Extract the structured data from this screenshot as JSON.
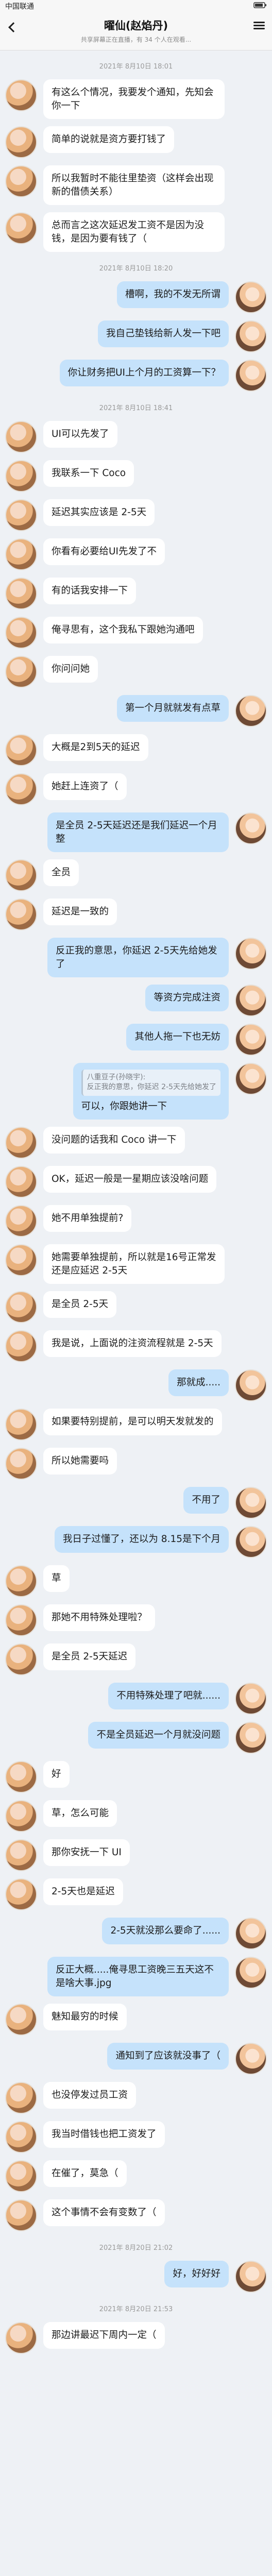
{
  "status_bar": {
    "carrier": "中国联通",
    "right_text": "",
    "battery_icon": "battery-icon"
  },
  "header": {
    "title": "曜仙(赵焰丹)",
    "notice": "共享屏幕正在直播，有 34 个人在观看...",
    "back_icon": "chevron-left-icon",
    "menu_icon": "menu-icon"
  },
  "messages": [
    {
      "type": "time",
      "text": "2021年 8月10日 18:01"
    },
    {
      "type": "msg",
      "side": "other",
      "text": "有这么个情况，我要发个通知，先知会你一下"
    },
    {
      "type": "msg",
      "side": "other",
      "text": "简单的说就是资方要打钱了"
    },
    {
      "type": "msg",
      "side": "other",
      "text": "所以我暂时不能往里垫资（这样会出现新的借债关系）"
    },
    {
      "type": "msg",
      "side": "other",
      "text": "总而言之这次延迟发工资不是因为没钱，是因为要有钱了（"
    },
    {
      "type": "time",
      "text": "2021年 8月10日 18:20"
    },
    {
      "type": "msg",
      "side": "me",
      "text": "槽啊，我的不发无所谓"
    },
    {
      "type": "msg",
      "side": "me",
      "text": "我自己垫钱给新人发一下吧"
    },
    {
      "type": "msg",
      "side": "me",
      "text": "你让财务把UI上个月的工资算一下？"
    },
    {
      "type": "time",
      "text": "2021年 8月10日 18:41"
    },
    {
      "type": "msg",
      "side": "other",
      "text": "UI可以先发了"
    },
    {
      "type": "msg",
      "side": "other",
      "text": "我联系一下 Coco"
    },
    {
      "type": "msg",
      "side": "other",
      "text": "延迟其实应该是 2-5天"
    },
    {
      "type": "msg",
      "side": "other",
      "text": "你看有必要给UI先发了不"
    },
    {
      "type": "msg",
      "side": "other",
      "text": "有的话我安排一下"
    },
    {
      "type": "msg",
      "side": "other",
      "text": "俺寻思有，这个我私下跟她沟通吧"
    },
    {
      "type": "msg",
      "side": "other",
      "text": "你问问她"
    },
    {
      "type": "msg",
      "side": "me",
      "text": "第一个月就就发有点草"
    },
    {
      "type": "msg",
      "side": "other",
      "text": "大概是2到5天的延迟"
    },
    {
      "type": "msg",
      "side": "other",
      "text": "她赶上连资了（"
    },
    {
      "type": "msg",
      "side": "me",
      "text": "是全员 2-5天延迟还是我们延迟一个月整"
    },
    {
      "type": "msg",
      "side": "other",
      "text": "全员"
    },
    {
      "type": "msg",
      "side": "other",
      "text": "延迟是一致的"
    },
    {
      "type": "msg",
      "side": "me",
      "text": "反正我的意思，你延迟 2-5天先给她发了"
    },
    {
      "type": "msg",
      "side": "me",
      "text": "等资方完成注资"
    },
    {
      "type": "msg",
      "side": "me",
      "text": "其他人拖一下也无妨"
    },
    {
      "type": "msg",
      "side": "me",
      "quote": {
        "name": "八重豆子(孙晓宇):",
        "text": "反正我的意思，你延迟 2-5天先给她发了"
      },
      "text": "可以，你跟她讲一下"
    },
    {
      "type": "msg",
      "side": "other",
      "text": "没问题的话我和 Coco 讲一下"
    },
    {
      "type": "msg",
      "side": "other",
      "text": "OK，延迟一般是一星期应该没啥问题"
    },
    {
      "type": "msg",
      "side": "other",
      "text": "她不用单独提前?"
    },
    {
      "type": "msg",
      "side": "other",
      "text": "她需要单独提前，所以就是16号正常发还是应延迟 2-5天"
    },
    {
      "type": "msg",
      "side": "other",
      "text": "是全员 2-5天"
    },
    {
      "type": "msg",
      "side": "other",
      "text": "我是说，上面说的注资流程就是 2-5天"
    },
    {
      "type": "msg",
      "side": "me",
      "text": "那就成....."
    },
    {
      "type": "msg",
      "side": "other",
      "text": "如果要特别提前，是可以明天发就发的"
    },
    {
      "type": "msg",
      "side": "other",
      "text": "所以她需要吗"
    },
    {
      "type": "msg",
      "side": "me",
      "text": "不用了"
    },
    {
      "type": "msg",
      "side": "me",
      "text": "我日子过懂了，还以为 8.15是下个月"
    },
    {
      "type": "msg",
      "side": "other",
      "text": "草"
    },
    {
      "type": "msg",
      "side": "other",
      "text": "那她不用特殊处理啦？"
    },
    {
      "type": "msg",
      "side": "other",
      "text": "是全员 2-5天延迟"
    },
    {
      "type": "msg",
      "side": "me",
      "text": "不用特殊处理了吧就......"
    },
    {
      "type": "msg",
      "side": "me",
      "text": "不是全员延迟一个月就没问题"
    },
    {
      "type": "msg",
      "side": "other",
      "text": "好"
    },
    {
      "type": "msg",
      "side": "other",
      "text": "草，怎么可能"
    },
    {
      "type": "msg",
      "side": "other",
      "text": "那你安抚一下 UI"
    },
    {
      "type": "msg",
      "side": "other",
      "text": "2-5天也是延迟"
    },
    {
      "type": "msg",
      "side": "me",
      "text": "2-5天就没那么要命了......"
    },
    {
      "type": "msg",
      "side": "me",
      "text": "反正大概.....俺寻思工资晚三五天这不是啥大事.jpg"
    },
    {
      "type": "msg",
      "side": "other",
      "text": "魅知最穷的时候"
    },
    {
      "type": "msg",
      "side": "me",
      "text": "通知到了应该就没事了（"
    },
    {
      "type": "msg",
      "side": "other",
      "text": "也没停发过员工资"
    },
    {
      "type": "msg",
      "side": "other",
      "text": "我当时借钱也把工资发了"
    },
    {
      "type": "msg",
      "side": "other",
      "text": "在催了，莫急（"
    },
    {
      "type": "msg",
      "side": "other",
      "text": "这个事情不会有变数了（"
    },
    {
      "type": "time",
      "text": "2021年 8月20日 21:02"
    },
    {
      "type": "msg",
      "side": "me",
      "text": "好，好好好"
    },
    {
      "type": "time",
      "text": "2021年 8月20日 21:53"
    },
    {
      "type": "msg",
      "side": "other",
      "text": "那边讲最迟下周内一定（"
    }
  ]
}
